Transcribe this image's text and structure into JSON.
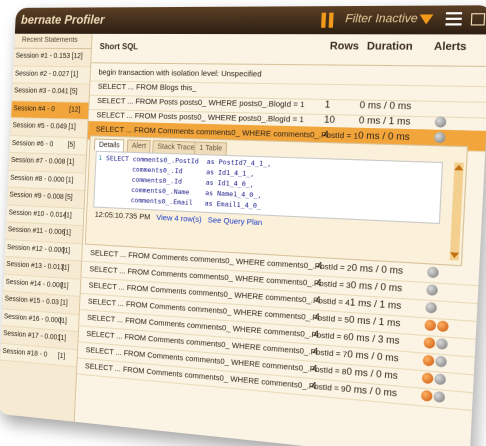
{
  "app": {
    "title": "bernate Profiler",
    "filter_label": "Filter Inactive"
  },
  "sidebar": {
    "header": "Recent Statements",
    "sessions": [
      {
        "label": "Session #1 - 0.153",
        "count": "[12]"
      },
      {
        "label": "Session #2 - 0.027",
        "count": "[1]"
      },
      {
        "label": "Session #3 - 0.041",
        "count": "[5]"
      },
      {
        "label": "Session #4 - 0",
        "count": "[12]"
      },
      {
        "label": "Session #5 - 0.049",
        "count": "[1]"
      },
      {
        "label": "Session #6 - 0",
        "count": "[5]"
      },
      {
        "label": "Session #7 - 0.008",
        "count": "[1]"
      },
      {
        "label": "Session #8 - 0.000",
        "count": "[1]"
      },
      {
        "label": "Session #9 - 0.008",
        "count": "[5]"
      },
      {
        "label": "Session #10 - 0.014",
        "count": "[1]"
      },
      {
        "label": "Session #11 - 0.006",
        "count": "[1]"
      },
      {
        "label": "Session #12 - 0.000",
        "count": "[1]"
      },
      {
        "label": "Session #13 - 0.013",
        "count": "[1]"
      },
      {
        "label": "Session #14 - 0.000",
        "count": "[1]"
      },
      {
        "label": "Session #15 - 0.03",
        "count": "[1]"
      },
      {
        "label": "Session #16 - 0.000",
        "count": "[1]"
      },
      {
        "label": "Session #17 - 0.001",
        "count": "[1]"
      },
      {
        "label": "Session #18 - 0",
        "count": "[1]"
      }
    ]
  },
  "columns": {
    "short_sql": "Short SQL",
    "rows": "Rows",
    "duration": "Duration",
    "alerts": "Alerts"
  },
  "statements": [
    {
      "sql": "begin transaction with isolation level: Unspecified",
      "rows": "",
      "duration": "",
      "alerts": []
    },
    {
      "sql": "SELECT ... FROM Blogs this_",
      "rows": "",
      "duration": "",
      "alerts": []
    },
    {
      "sql": "SELECT ... FROM Posts posts0_ WHERE posts0_.BlogId = 1",
      "rows": "1",
      "duration": "0 ms / 0 ms",
      "alerts": []
    },
    {
      "sql": "SELECT ... FROM Posts posts0_ WHERE posts0_.BlogId = 1",
      "rows": "10",
      "duration": "0 ms / 1 ms",
      "alerts": [
        "gray"
      ]
    },
    {
      "sql": "SELECT ... FROM Comments comments0_ WHERE comments0_.PostId = 1",
      "rows": "4",
      "duration": "0 ms / 0 ms",
      "alerts": [
        "gray"
      ]
    },
    {
      "sql": "SELECT ... FROM Comments comments0_ WHERE comments0_.PostId = 2",
      "rows": "4",
      "duration": "0 ms / 0 ms",
      "alerts": [
        "gray"
      ]
    },
    {
      "sql": "SELECT ... FROM Comments comments0_ WHERE comments0_.PostId = 3",
      "rows": "4",
      "duration": "0 ms / 0 ms",
      "alerts": [
        "gray"
      ]
    },
    {
      "sql": "SELECT ... FROM Comments comments0_ WHERE comments0_.PostId = 4",
      "rows": "4",
      "duration": "1 ms / 1 ms",
      "alerts": [
        "gray"
      ]
    },
    {
      "sql": "SELECT ... FROM Comments comments0_ WHERE comments0_.PostId = 5",
      "rows": "4",
      "duration": "0 ms / 1 ms",
      "alerts": [
        "orange",
        "orange"
      ]
    },
    {
      "sql": "SELECT ... FROM Comments comments0_ WHERE comments0_.PostId = 6",
      "rows": "4",
      "duration": "0 ms / 3 ms",
      "alerts": [
        "orange",
        "gray"
      ]
    },
    {
      "sql": "SELECT ... FROM Comments comments0_ WHERE comments0_.PostId = 7",
      "rows": "4",
      "duration": "0 ms / 0 ms",
      "alerts": [
        "orange",
        "gray"
      ]
    },
    {
      "sql": "SELECT ... FROM Comments comments0_ WHERE comments0_.PostId = 8",
      "rows": "4",
      "duration": "0 ms / 0 ms",
      "alerts": [
        "orange",
        "gray"
      ]
    },
    {
      "sql": "SELECT ... FROM Comments comments0_ WHERE comments0_.PostId = 9",
      "rows": "4",
      "duration": "0 ms / 0 ms",
      "alerts": [
        "orange",
        "gray"
      ]
    }
  ],
  "detail": {
    "tabs": [
      "Details",
      "Alert",
      "Stack Trace",
      "1 Table"
    ],
    "code_lines": [
      "SELECT comments0_.PostId  as PostId7_4_1_,",
      "       comments0_.Id      as Id1_4_1_,",
      "       comments0_.Id      as Id1_4_0_,",
      "       comments0_.Name    as Name1_4_0_,",
      "       comments0_.Email   as Email1_4_0_"
    ],
    "timestamp": "12:05:10.735 PM",
    "view_rows": "View 4 row(s)",
    "query_plan": "See Query Plan"
  },
  "colors": {
    "accent": "#f2a53b",
    "titlebar": "#3d2a18",
    "alert_gray": "#9a9a9a",
    "alert_orange": "#e06a14"
  }
}
